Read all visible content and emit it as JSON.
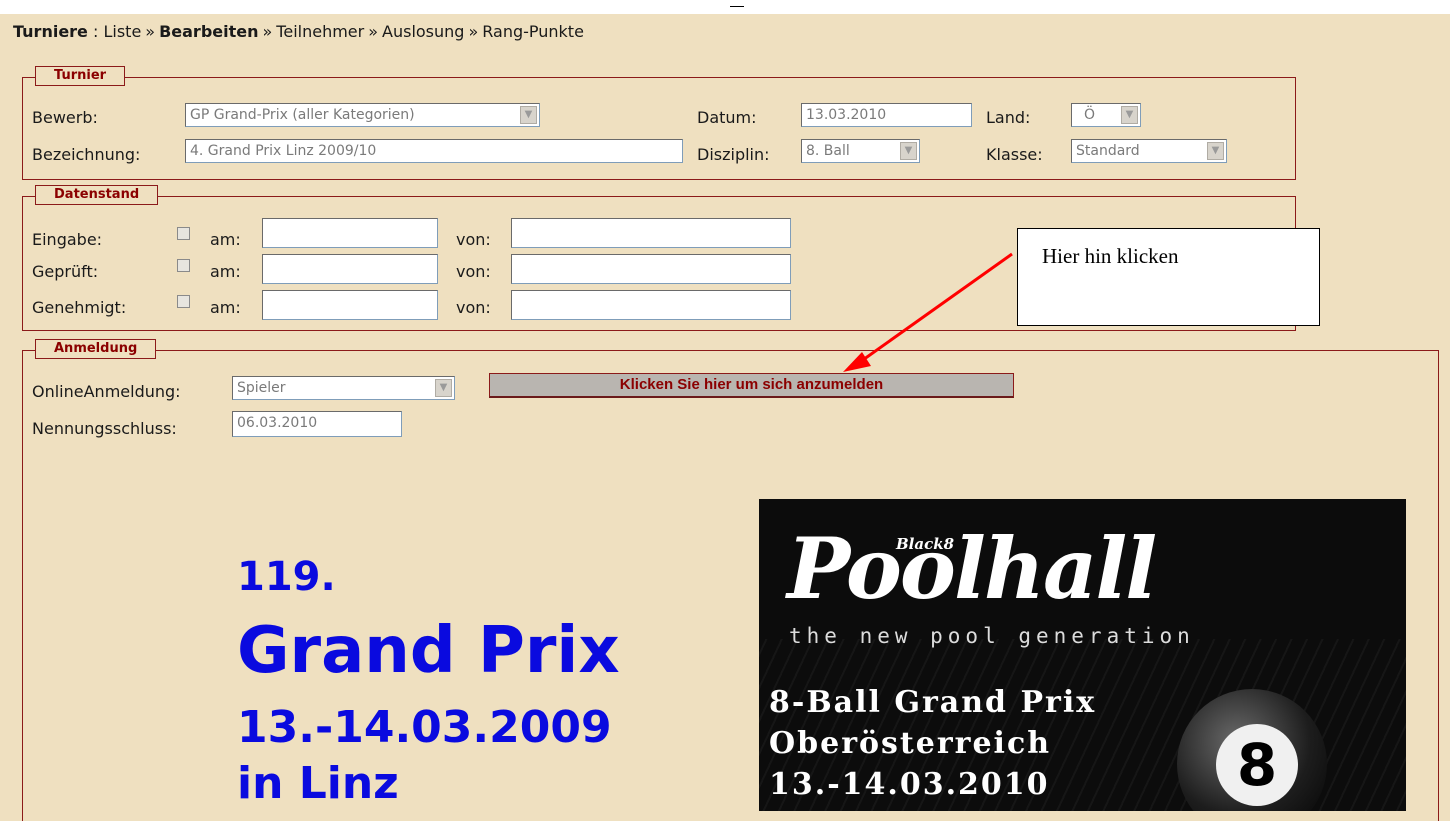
{
  "breadcrumb": {
    "root": "Turniere",
    "colon": " : ",
    "items": [
      "Liste",
      "Bearbeiten",
      "Teilnehmer",
      "Auslosung",
      "Rang-Punkte"
    ],
    "separator": "»"
  },
  "turnier": {
    "legend": "Turnier",
    "bewerb_label": "Bewerb:",
    "bewerb_value": "GP  Grand-Prix (aller Kategorien)",
    "datum_label": "Datum:",
    "datum_value": "13.03.2010",
    "land_label": "Land:",
    "land_value": "Ö",
    "bezeichnung_label": "Bezeichnung:",
    "bezeichnung_value": "4. Grand Prix Linz 2009/10",
    "disziplin_label": "Disziplin:",
    "disziplin_value": "8. Ball",
    "klasse_label": "Klasse:",
    "klasse_value": "Standard"
  },
  "datenstand": {
    "legend": "Datenstand",
    "rows": [
      {
        "label": "Eingabe:",
        "am": "am:",
        "von": "von:"
      },
      {
        "label": "Geprüft:",
        "am": "am:",
        "von": "von:"
      },
      {
        "label": "Genehmigt:",
        "am": "am:",
        "von": "von:"
      }
    ]
  },
  "callout": {
    "text": "Hier hin klicken"
  },
  "anmeldung": {
    "legend": "Anmeldung",
    "online_label": "OnlineAnmeldung:",
    "online_value": "Spieler",
    "register_button": "Klicken Sie hier um sich anzumelden",
    "nennungsschluss_label": "Nennungsschluss:",
    "nennungsschluss_value": "06.03.2010"
  },
  "flyer": {
    "number": "119.",
    "title": "Grand Prix",
    "dates": "13.-14.03.2009",
    "place": "in Linz"
  },
  "poster": {
    "brand_small": "Black8",
    "brand": "Poolhall",
    "tagline": "the new pool generation",
    "line1": "8-Ball Grand Prix",
    "line2": "Oberösterreich",
    "line3": "13.-14.03.2010",
    "ball_number": "8"
  },
  "colors": {
    "background": "#efe0c0",
    "border": "#8b1a1a",
    "legend_text": "#8b0000",
    "flyer_blue": "#0a0adf",
    "arrow": "#ff0000"
  }
}
